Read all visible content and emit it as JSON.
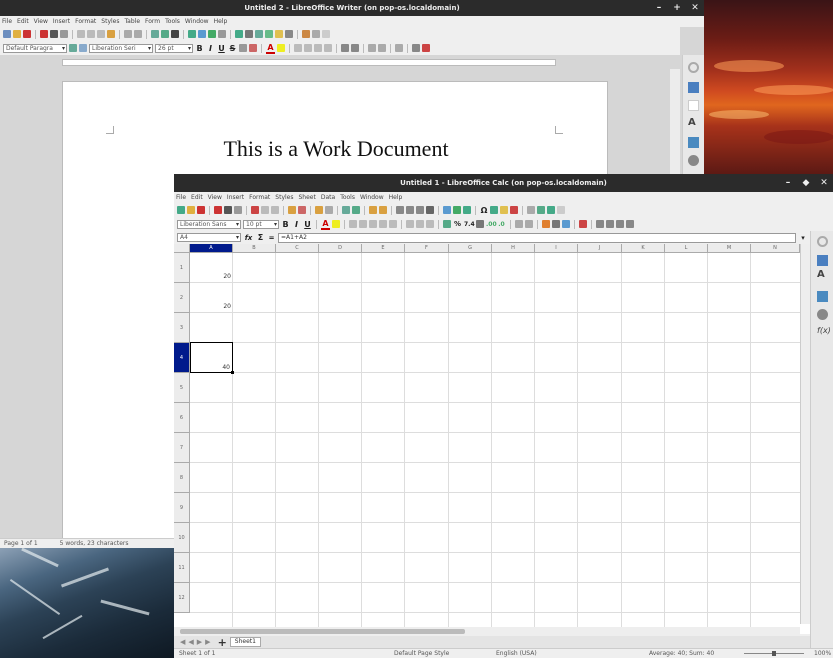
{
  "writer": {
    "title": "Untitled 2 - LibreOffice Writer (on pop-os.localdomain)",
    "menu": [
      "File",
      "Edit",
      "View",
      "Insert",
      "Format",
      "Styles",
      "Table",
      "Form",
      "Tools",
      "Window",
      "Help"
    ],
    "para_style": "Default Paragra",
    "font_name": "Liberation Seri",
    "font_size": "26 pt",
    "heading": "This is a Work Document",
    "status_page": "Page 1 of 1",
    "status_words": "5 words, 23 characters"
  },
  "calc": {
    "title": "Untitled 1 - LibreOffice Calc (on pop-os.localdomain)",
    "menu": [
      "File",
      "Edit",
      "View",
      "Insert",
      "Format",
      "Styles",
      "Sheet",
      "Data",
      "Tools",
      "Window",
      "Help"
    ],
    "font_name": "Liberation Sans",
    "font_size": "10 pt",
    "name_box": "A4",
    "formula": "=A1+A2",
    "columns": [
      "A",
      "B",
      "C",
      "D",
      "E",
      "F",
      "G",
      "H",
      "I",
      "J",
      "K",
      "L",
      "M",
      "N"
    ],
    "rows": [
      "1",
      "2",
      "3",
      "4",
      "5",
      "6",
      "7",
      "8",
      "9",
      "10",
      "11",
      "12"
    ],
    "cells": {
      "A1": "20",
      "A2": "20",
      "A4": "40"
    },
    "sheet_tab": "Sheet1",
    "status": {
      "sheet": "Sheet 1 of 1",
      "page_style": "Default Page Style",
      "language": "English (USA)",
      "summary": "Average: 40; Sum: 40",
      "zoom": "100%"
    }
  },
  "colors": {
    "selected_header": "#001a8c",
    "titlebar": "#2b2b2b"
  }
}
